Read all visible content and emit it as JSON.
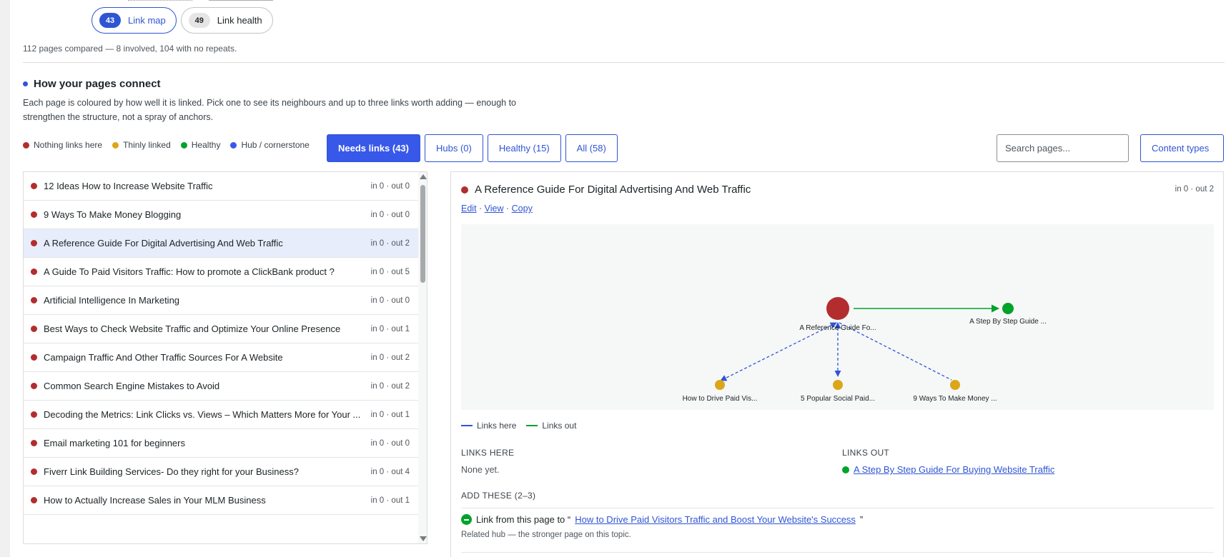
{
  "tabs": [
    {
      "count": "43",
      "label": "Link map",
      "active": true
    },
    {
      "count": "49",
      "label": "Link health",
      "active": false
    }
  ],
  "summary": "112 pages compared — 8 involved, 104 with no repeats.",
  "section": {
    "title": "How your pages connect",
    "description": "Each page is coloured by how well it is linked. Pick one to see its neighbours and up to three links worth adding — enough to strengthen the structure, not a spray of anchors."
  },
  "legend": [
    {
      "label": "Nothing links here",
      "color": "#b32d2e"
    },
    {
      "label": "Thinly linked",
      "color": "#dba617"
    },
    {
      "label": "Healthy",
      "color": "#00a32a"
    },
    {
      "label": "Hub / cornerstone",
      "color": "#3858e9"
    }
  ],
  "filters": [
    "Needs links (43)",
    "Hubs (0)",
    "Healthy (15)",
    "All (58)"
  ],
  "search": {
    "placeholder": "Search pages..."
  },
  "content_types_label": "Content types",
  "pages": [
    {
      "title": "12 Ideas How to Increase Website Traffic",
      "meta": "in 0 · out 0"
    },
    {
      "title": "9 Ways To Make Money Blogging",
      "meta": "in 0 · out 0"
    },
    {
      "title": "A Reference Guide For Digital Advertising And Web Traffic",
      "meta": "in 0 · out 2"
    },
    {
      "title": "A Guide To Paid Visitors Traffic: How to promote a ClickBank product ?",
      "meta": "in 0 · out 5"
    },
    {
      "title": "Artificial Intelligence In Marketing",
      "meta": "in 0 · out 0"
    },
    {
      "title": "Best Ways to Check Website Traffic and Optimize Your Online Presence",
      "meta": "in 0 · out 1"
    },
    {
      "title": "Campaign Traffic And Other Traffic Sources For A Website",
      "meta": "in 0 · out 2"
    },
    {
      "title": "Common Search Engine Mistakes to Avoid",
      "meta": "in 0 · out 2"
    },
    {
      "title": "Decoding the Metrics: Link Clicks vs. Views – Which Matters More for Your ...",
      "meta": "in 0 · out 1"
    },
    {
      "title": "Email marketing 101 for beginners",
      "meta": "in 0 · out 0"
    },
    {
      "title": "Fiverr Link Building Services- Do they right for your Business?",
      "meta": "in 0 · out 4"
    },
    {
      "title": "How to Actually Increase Sales in Your MLM Business",
      "meta": "in 0 · out 1"
    }
  ],
  "selected_index": 2,
  "detail": {
    "title": "A Reference Guide For Digital Advertising And Web Traffic",
    "meta": "in 0 · out 2",
    "actions": {
      "edit": "Edit",
      "view": "View",
      "copy": "Copy",
      "sep": " · "
    },
    "graph_nodes": {
      "center": "A Reference Guide Fo...",
      "out": "A Step By Step Guide ...",
      "s1": "How to Drive Paid Vis...",
      "s2": "5 Popular Social Paid...",
      "s3": "9 Ways To Make Money ..."
    },
    "graph_legend": {
      "here": "Links here",
      "out": "Links out"
    },
    "links_here_head": "LINKS HERE",
    "links_here_value": "None yet.",
    "links_out_head": "LINKS OUT",
    "links_out_item": "A Step By Step Guide For Buying Website Traffic",
    "add_head": "ADD THESE (2–3)",
    "add_prefix": "Link from this page to “",
    "add_link": "How to Drive Paid Visitors Traffic and Boost Your Website's Success",
    "add_suffix": "”",
    "add_note": "Related hub — the stronger page on this topic."
  },
  "colors": {
    "accent": "#3858e9",
    "red": "#b32d2e",
    "amber": "#dba617",
    "green": "#00a32a",
    "blue_dash": "#2f55d4"
  }
}
